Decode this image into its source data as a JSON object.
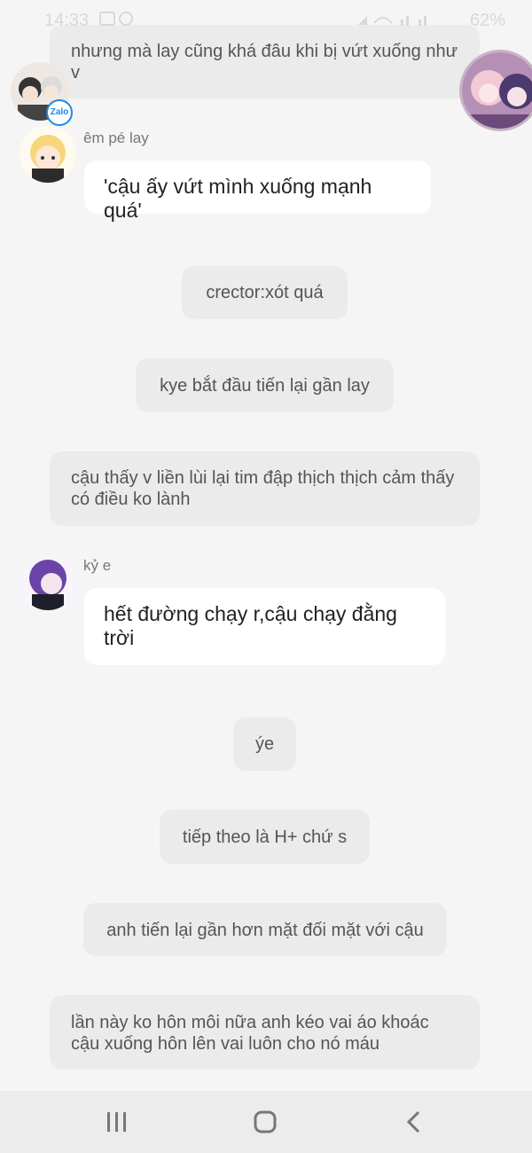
{
  "status_bar": {
    "time": "14:33",
    "battery": "62%"
  },
  "messages": {
    "top_partial": "nhưng mà lay cũng khá đâu khi bị vứt xuống như v",
    "em_pe_lay_name": "êm pé lay",
    "em_pe_lay_text": "'cậu ấy vứt mình xuống mạnh quá'",
    "crector": "crector:xót quá",
    "kye_approach": "kye bắt đầu tiến lại gần lay",
    "cau_thay": "cậu thấy v liền lùi lại tim đập thịch thịch cảm thấy có điều ko lành",
    "ky_e_name": "kỷ e",
    "ky_e_text": "hết đường chạy r,cậu chạy đằng trời",
    "ye": "ýe",
    "tiep_theo": "tiếp theo là H+ chứ s",
    "anh_tien": "anh tiến lại gần hơn mặt đối mặt với cậu",
    "lan_nay": "lần này ko hôn môi nữa anh kéo vai áo khoác cậu xuống hôn lên vai luôn cho nó máu"
  },
  "zalo_badge": "Zalo",
  "icons": {
    "recent_apps": "recent-apps-icon",
    "home": "home-icon",
    "back": "back-icon"
  }
}
